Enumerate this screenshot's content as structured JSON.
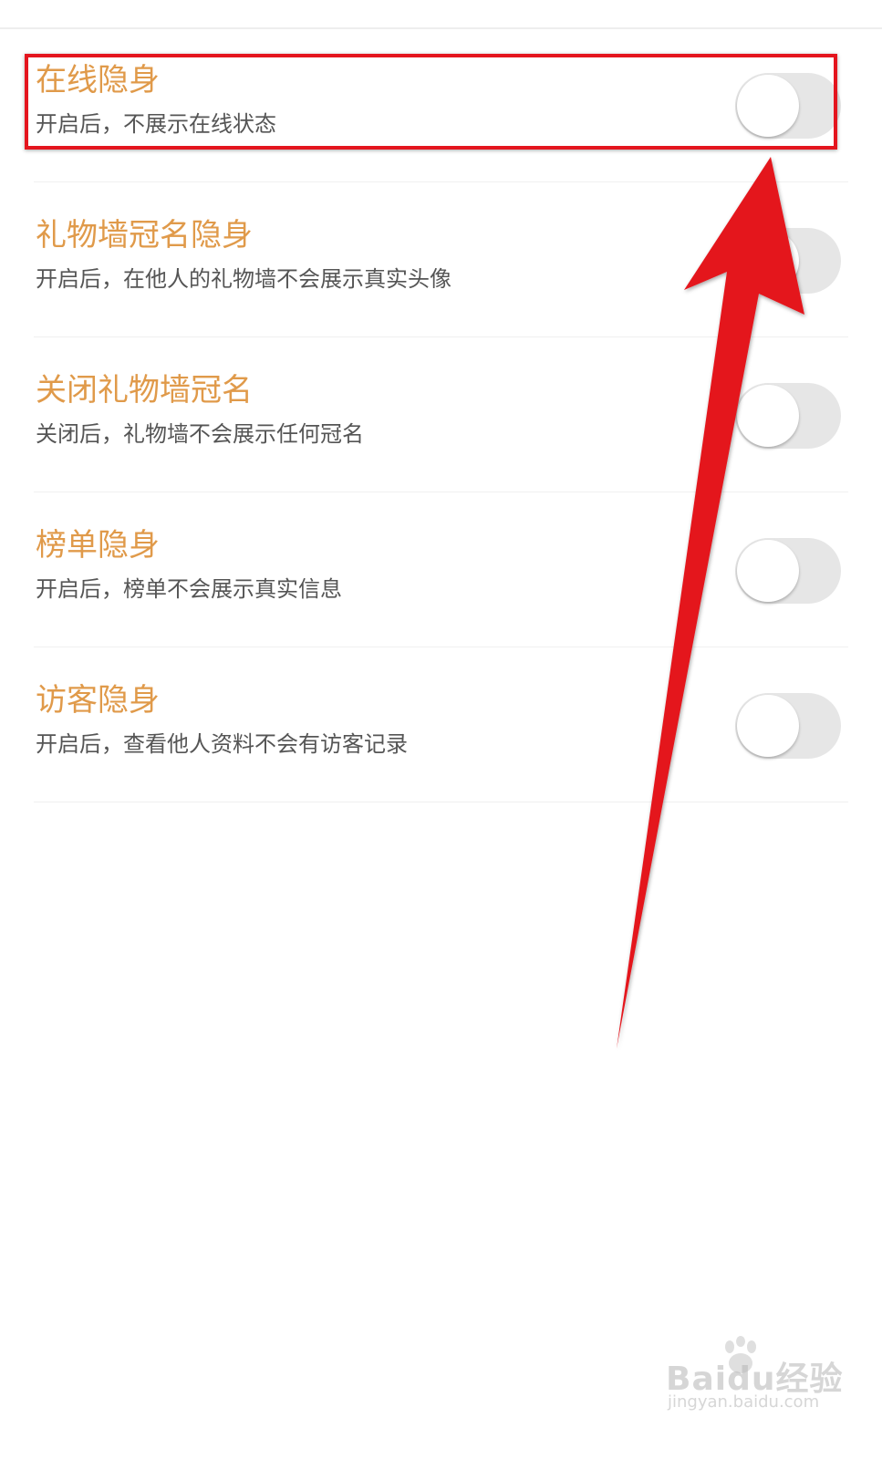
{
  "settings": [
    {
      "title": "在线隐身",
      "desc": "开启后，不展示在线状态",
      "enabled": false,
      "highlighted": true
    },
    {
      "title": "礼物墙冠名隐身",
      "desc": "开启后，在他人的礼物墙不会展示真实头像",
      "enabled": false,
      "highlighted": false
    },
    {
      "title": "关闭礼物墙冠名",
      "desc": "关闭后，礼物墙不会展示任何冠名",
      "enabled": false,
      "highlighted": false
    },
    {
      "title": "榜单隐身",
      "desc": "开启后，榜单不会展示真实信息",
      "enabled": false,
      "highlighted": false
    },
    {
      "title": "访客隐身",
      "desc": "开启后，查看他人资料不会有访客记录",
      "enabled": false,
      "highlighted": false
    }
  ],
  "watermark": {
    "title": "Baidu经验",
    "url": "jingyan.baidu.com"
  },
  "colors": {
    "title": "#e09a4a",
    "description": "#555555",
    "toggle_off_track": "#e6e6e6",
    "annotation_red": "#e4151e"
  }
}
